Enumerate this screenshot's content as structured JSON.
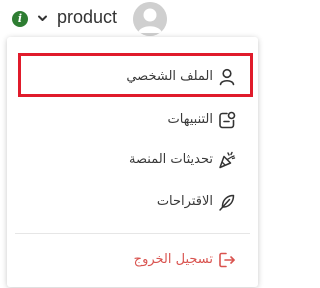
{
  "topbar": {
    "info_icon": "info-icon",
    "info_glyph": "i",
    "account_label": "product",
    "chevron_icon": "chevron-down-icon",
    "avatar_icon": "default-avatar-icon"
  },
  "menu": {
    "items": [
      {
        "label": "الملف الشخصي",
        "icon": "user-icon"
      },
      {
        "label": "التنبيهات",
        "icon": "notification-icon"
      },
      {
        "label": "تحديثات المنصة",
        "icon": "party-popper-icon"
      },
      {
        "label": "الاقتراحات",
        "icon": "feather-icon"
      }
    ],
    "logout": {
      "label": "تسجيل الخروج",
      "icon": "logout-icon"
    }
  },
  "colors": {
    "info_green": "#2e7d32",
    "logout_red": "#d9534f",
    "highlight_red": "#e01b2b",
    "text": "#3a3a3a"
  }
}
